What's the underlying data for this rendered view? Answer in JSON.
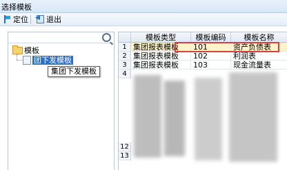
{
  "window": {
    "title": "选择模板"
  },
  "toolbar": {
    "locate_label": "定位",
    "exit_label": "退出"
  },
  "search": {
    "placeholder": "",
    "value": ""
  },
  "tree": {
    "root_label": "模板",
    "child_label": "集团下发模板",
    "child_label_visible": "团下发模板",
    "tooltip": "集团下发模板"
  },
  "table": {
    "columns": [
      "模板类型",
      "模板编码",
      "模板名称"
    ],
    "rows": [
      {
        "num": "1",
        "type": "集团报表模板",
        "code": "101",
        "name": "资产负债表"
      },
      {
        "num": "2",
        "type": "集团报表模板",
        "code": "102",
        "name": "利润表"
      },
      {
        "num": "3",
        "type": "集团报表模板",
        "code": "103",
        "name": "现金流量表"
      },
      {
        "num": "4",
        "type": "",
        "code": "",
        "name": ""
      }
    ],
    "row_numbers_lower": [
      "12",
      "13"
    ]
  },
  "colors": {
    "highlight": "#e03c3c",
    "selection": "#2f6fc4"
  }
}
